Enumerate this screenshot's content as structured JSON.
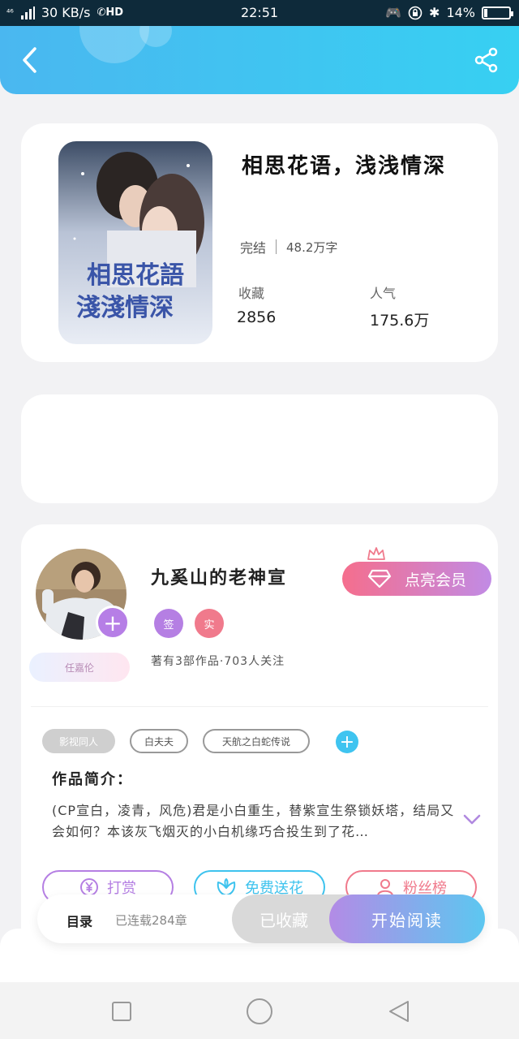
{
  "status_bar": {
    "network": "⁴⁶",
    "speed": "30 KB/s",
    "hd": "HD",
    "time": "22:51",
    "battery": "14%",
    "battery_level": 0.14
  },
  "header": {
    "back_icon": "chevron-left-icon",
    "share_icon": "share-icon",
    "gradient_from": "#4ab7f0",
    "gradient_to": "#37d0f2"
  },
  "book": {
    "title": "相思花语，浅浅情深",
    "status": "完结",
    "word_count": "48.2万字",
    "favorites_label": "收藏",
    "favorites_value": "2856",
    "popularity_label": "人气",
    "popularity_value": "175.6万",
    "cover_text_line1": "相思花語",
    "cover_text_line2": "淺淺情深"
  },
  "author": {
    "name": "九奚山的老神宣",
    "name_bubble": "任嘉伦",
    "member_button": "点亮会员",
    "badge_sign": "签",
    "badge_real": "实",
    "works_info": "著有3部作品·703人关注"
  },
  "tags": [
    "影视同人",
    "白夫夫",
    "天航之白蛇传说"
  ],
  "intro": {
    "title": "作品简介：",
    "text": "(CP宣白，凌青，风危)君是小白重生，替紫宣生祭锁妖塔，结局又会如何？本该灰飞烟灭的小白机缘巧合投生到了花…"
  },
  "actions": {
    "reward": "打赏",
    "flower": "免费送花",
    "fans": "粉丝榜",
    "reward_color": "#b57fe3",
    "flower_color": "#3ec3ee",
    "fans_color": "#f07a8c"
  },
  "read_bar": {
    "toc": "目录",
    "chapters": "已连载284章",
    "collected": "已收藏",
    "start_read": "开始阅读"
  },
  "nav": {
    "recents_icon": "square-icon",
    "home_icon": "circle-icon",
    "back_icon": "triangle-back-icon"
  }
}
